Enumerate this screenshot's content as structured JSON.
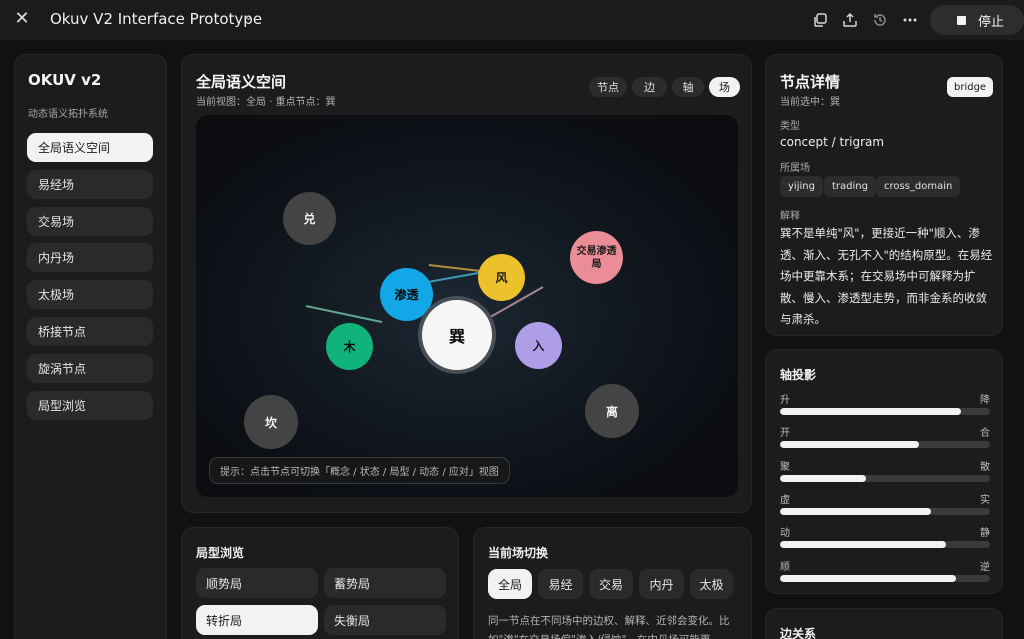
{
  "app": {
    "title": "Okuv V2 Interface Prototype",
    "stop_label": "停止"
  },
  "toolbar_icons": [
    "copy-icon",
    "share-icon",
    "history-icon",
    "more-icon"
  ],
  "sidebar": {
    "brand": "OKUV v2",
    "subtitle": "动态语义拓扑系统",
    "items": [
      {
        "label": "全局语义空间",
        "active": true
      },
      {
        "label": "易经场",
        "active": false
      },
      {
        "label": "交易场",
        "active": false
      },
      {
        "label": "内丹场",
        "active": false
      },
      {
        "label": "太极场",
        "active": false
      },
      {
        "label": "桥接节点",
        "active": false
      },
      {
        "label": "旋涡节点",
        "active": false
      },
      {
        "label": "局型浏览",
        "active": false
      }
    ]
  },
  "graph": {
    "title": "全局语义空间",
    "subtitle": "当前视图：全局 · 重点节点：巽",
    "tabs": [
      {
        "label": "节点",
        "active": false
      },
      {
        "label": "边",
        "active": false
      },
      {
        "label": "轴",
        "active": false
      },
      {
        "label": "场",
        "active": true
      }
    ],
    "nodes": {
      "dui": "兑",
      "xun": "巽",
      "wind": "风",
      "seep": "渗透",
      "wood": "木",
      "enter": "入",
      "trade_seep": "交易渗透局",
      "kan": "坎",
      "li": "离"
    },
    "hint": "提示：点击节点可切换「概念 / 状态 / 局型 / 动态 / 应对」视图",
    "colors": {
      "seep": "#12a7e6",
      "wind": "#ecc12b",
      "wood": "#10b37a",
      "enter": "#ae9ee8",
      "trade_seep": "#ea8d96",
      "gray_node": "#444444",
      "center": "#f6f6f6"
    }
  },
  "patterns": {
    "title": "局型浏览",
    "items": [
      {
        "label": "顺势局",
        "active": false
      },
      {
        "label": "蓄势局",
        "active": false
      },
      {
        "label": "转折局",
        "active": true
      },
      {
        "label": "失衡局",
        "active": false
      }
    ]
  },
  "field_switch": {
    "title": "当前场切换",
    "items": [
      {
        "label": "全局",
        "active": true
      },
      {
        "label": "易经",
        "active": false
      },
      {
        "label": "交易",
        "active": false
      },
      {
        "label": "内丹",
        "active": false
      },
      {
        "label": "太极",
        "active": false
      }
    ],
    "description": "同一节点在不同场中的边权、解释、近邻会变化。比如\"渗\"在交易场偏\"渗入/侵蚀\"，在内丹场可能更"
  },
  "details": {
    "title": "节点详情",
    "badge": "bridge",
    "selected": "当前选中：巽",
    "type_label": "类型",
    "type_value": "concept / trigram",
    "fields_label": "所属场",
    "fields": [
      "yijing",
      "trading",
      "cross_domain"
    ],
    "desc_label": "解释",
    "description": "巽不是单纯\"风\"，更接近一种\"顺入、渗透、渐入、无孔不入\"的结构原型。在易经场中更靠木系；在交易场中可解释为扩散、慢入、渗透型走势，而非金系的收敛与肃杀。"
  },
  "axis_projection": {
    "title": "轴投影",
    "axes": [
      {
        "left": "升",
        "right": "降",
        "value": 0.86
      },
      {
        "left": "开",
        "right": "合",
        "value": 0.66
      },
      {
        "left": "聚",
        "right": "散",
        "value": 0.41
      },
      {
        "left": "虚",
        "right": "实",
        "value": 0.72
      },
      {
        "left": "动",
        "right": "静",
        "value": 0.79
      },
      {
        "left": "顺",
        "right": "逆",
        "value": 0.84
      }
    ]
  },
  "edge_relations": {
    "title": "边关系"
  }
}
